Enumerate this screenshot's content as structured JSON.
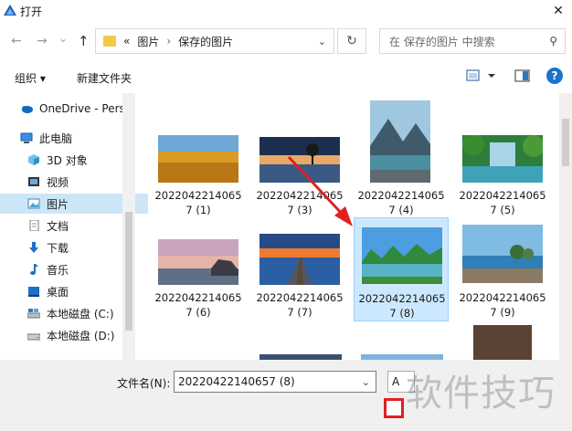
{
  "window": {
    "title": "打开",
    "close_glyph": "✕"
  },
  "nav": {
    "back": "←",
    "forward": "→",
    "recent": "⌄",
    "up": "↑",
    "address": {
      "prefix": "«",
      "path1": "图片",
      "sep": "›",
      "path2": "保存的图片"
    },
    "refresh": "↻",
    "search_placeholder": "在 保存的图片 中搜索"
  },
  "toolbar": {
    "organize": "组织 ▾",
    "new_folder": "新建文件夹",
    "help": "?"
  },
  "sidebar": {
    "items": [
      {
        "label": "OneDrive - Pers",
        "icon": "cloud-icon"
      },
      {
        "label": "此电脑",
        "icon": "computer-icon"
      },
      {
        "label": "3D 对象",
        "icon": "cube-icon"
      },
      {
        "label": "视频",
        "icon": "video-icon"
      },
      {
        "label": "图片",
        "icon": "pictures-icon"
      },
      {
        "label": "文档",
        "icon": "document-icon"
      },
      {
        "label": "下载",
        "icon": "download-icon"
      },
      {
        "label": "音乐",
        "icon": "music-icon"
      },
      {
        "label": "桌面",
        "icon": "desktop-icon"
      },
      {
        "label": "本地磁盘 (C:)",
        "icon": "drive-icon"
      },
      {
        "label": "本地磁盘 (D:)",
        "icon": "drive-icon"
      }
    ]
  },
  "files": [
    {
      "line1": "2022042214065",
      "line2": "7 (1)",
      "scene": "wheat"
    },
    {
      "line1": "2022042214065",
      "line2": "7 (3)",
      "scene": "lake-sunset"
    },
    {
      "line1": "2022042214065",
      "line2": "7 (4)",
      "scene": "mountain"
    },
    {
      "line1": "2022042214065",
      "line2": "7 (5)",
      "scene": "waterfall"
    },
    {
      "line1": "2022042214065",
      "line2": "7 (6)",
      "scene": "sea-pink"
    },
    {
      "line1": "2022042214065",
      "line2": "7 (7)",
      "scene": "pier"
    },
    {
      "line1": "2022042214065",
      "line2": "7 (8)",
      "scene": "karst"
    },
    {
      "line1": "2022042214065",
      "line2": "7 (9)",
      "scene": "coast"
    }
  ],
  "bottom": {
    "filename_label": "文件名(N):",
    "filename_value": "20220422140657 (8)",
    "filter_text": "A"
  },
  "watermark": "软件技巧",
  "colors": {
    "selection": "#cce8ff",
    "accent": "#1a73c8",
    "annotation": "#e02020"
  }
}
